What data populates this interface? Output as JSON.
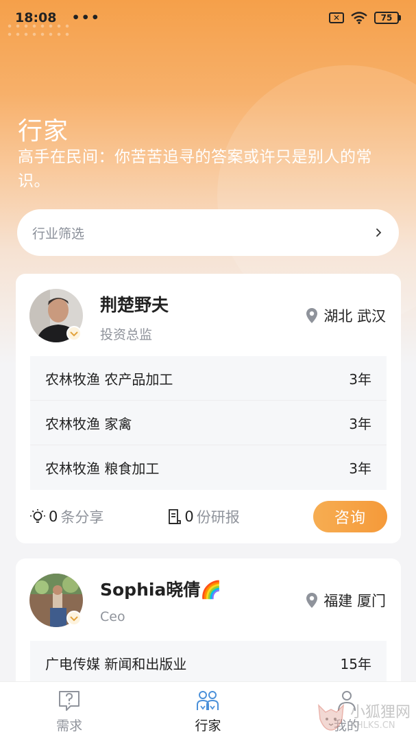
{
  "status_bar": {
    "time": "18:08",
    "more": "•••",
    "battery": "75"
  },
  "header": {
    "title": "行家",
    "subtitle": "高手在民间：你苦苦追寻的答案或许只是别人的常识。"
  },
  "filter": {
    "label": "行业筛选"
  },
  "experts": [
    {
      "name": "荆楚野夫",
      "role": "投资总监",
      "location": "湖北 武汉",
      "industries": [
        {
          "name": "农林牧渔 农产品加工",
          "years": "3年"
        },
        {
          "name": "农林牧渔 家禽",
          "years": "3年"
        },
        {
          "name": "农林牧渔 粮食加工",
          "years": "3年"
        }
      ],
      "shares_count": "0",
      "shares_unit": "条分享",
      "reports_count": "0",
      "reports_unit": "份研报",
      "consult_label": "咨询"
    },
    {
      "name": "Sophia晓倩🌈",
      "role": "Ceo",
      "location": "福建 厦门",
      "industries": [
        {
          "name": "广电传媒 新闻和出版业",
          "years": "15年"
        }
      ]
    }
  ],
  "tab_bar": {
    "items": [
      {
        "label": "需求",
        "icon": "question-icon"
      },
      {
        "label": "行家",
        "icon": "experts-icon"
      },
      {
        "label": "我的",
        "icon": "profile-icon"
      }
    ],
    "active": "行家"
  },
  "watermark": {
    "text": "小狐狸网",
    "sub": "XHLKS.CN"
  },
  "colors": {
    "accent": "#f5a04a",
    "button": "#f59a3a"
  }
}
